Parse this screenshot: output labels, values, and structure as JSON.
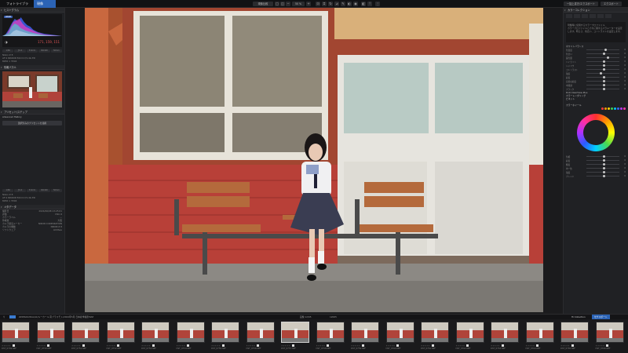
{
  "topbar": {
    "tabs": [
      "フォトライブラリ",
      "現像"
    ],
    "center_buttons": [
      "現像比較"
    ],
    "zoom": "50 %",
    "right_buttons": [
      "一括上書き/エクスポート",
      "エクスポート"
    ]
  },
  "left_panel": {
    "histogram_title": "ヒストグラム",
    "histogram_badge": "sRGB",
    "rgb_readout": "171, 159, 151",
    "exif_chips": [
      "1/80",
      "ƒ/1.4",
      "5.6mm",
      "ISO400",
      "50mm"
    ],
    "exif_line1": "Nikon Z 8",
    "exif_line2": "AF-S NIKKOR 50mm f/1.4G ED",
    "exif_line3": "8256 × 5504",
    "navigator_title": "情報パネル",
    "presets_title": "プリセット/ステップ",
    "history_label": "Advanced History",
    "history_button": "選択済みのプリセットを適用",
    "lower_exif_chips": [
      "1/80",
      "ƒ/1.4",
      "5.6mm",
      "ISO400",
      "50mm"
    ],
    "lower_line1": "Nikon Z 8",
    "lower_line2": "AF-S NIKKOR 50mm f/1.4G ED",
    "lower_line3": "8256 × 5504",
    "meta_title": "メタデータ",
    "meta_rows": [
      [
        "撮影日",
        "2024/06/08 13:25:01"
      ],
      [
        "評価",
        "DSC-9"
      ],
      [
        "カラーラベル",
        "—"
      ],
      [
        "作成者",
        "大阪"
      ],
      [
        "カメラ製造メーカー",
        "NIKON CORPORATION"
      ],
      [
        "カメラの機種",
        "NIKON Z 8"
      ],
      [
        "ソフトウェア",
        "ACDSee"
      ]
    ]
  },
  "right_panel": {
    "title": "カラーコレクション",
    "note_line1": "現像時に使用するカラープロファイル",
    "note_line2": "カラープロファイルとそれに関するパラメーターを設定",
    "note_line3": "します。明るさ、色合い、コントラストを設定します。",
    "sections": [
      "ホワイトバランス",
      "露出補正",
      "トーン",
      "DxO ClearView Plus",
      "カラーレンダリング",
      "ビネット",
      "カラーホイール"
    ],
    "sliders": [
      {
        "label": "色温度",
        "pos": 0.55,
        "value": "0"
      },
      {
        "label": "色合い",
        "pos": 0.5,
        "value": "0"
      },
      {
        "label": "露光量",
        "pos": 0.62,
        "value": "0"
      },
      {
        "label": "ハイライト",
        "pos": 0.5,
        "value": "0"
      },
      {
        "label": "シャドウ",
        "pos": 0.5,
        "value": "0"
      },
      {
        "label": "コントラスト",
        "pos": 0.5,
        "value": "0"
      },
      {
        "label": "強度",
        "pos": 0.4,
        "value": "0"
      },
      {
        "label": "彩度",
        "pos": 0.5,
        "value": "0"
      },
      {
        "label": "自然な彩度",
        "pos": 0.5,
        "value": "0"
      },
      {
        "label": "中間調",
        "pos": 0.5,
        "value": "0"
      },
      {
        "label": "ブラック",
        "pos": 0.5,
        "value": "0"
      }
    ],
    "lower_sliders": [
      {
        "label": "色相",
        "pos": 0.5,
        "value": "0"
      },
      {
        "label": "彩度",
        "pos": 0.5,
        "value": "0"
      },
      {
        "label": "輝度",
        "pos": 0.5,
        "value": "0"
      },
      {
        "label": "均一性",
        "pos": 0.5,
        "value": "0"
      },
      {
        "label": "強度",
        "pos": 0.5,
        "value": "0"
      },
      {
        "label": "ブレンド",
        "pos": 0.5,
        "value": "0"
      }
    ],
    "swatch_colors": [
      "#ff3a3a",
      "#ff9a00",
      "#ffd600",
      "#3fd04f",
      "#00c8ff",
      "#3a63ff",
      "#b438ff",
      "#ff38a8"
    ]
  },
  "filmstrip_bar": {
    "path": "ZZDMA02DAA/Lt/ルーカール 南ブラスモト/2024年5月 日本夏季撮影MAP",
    "center_label": "画像 12/65",
    "center_count": "12065",
    "collection": "Hi Collection",
    "button": "セクスポート"
  },
  "thumbnails": [
    {
      "name": "DST_0749.NEF",
      "selected": false
    },
    {
      "name": "DST_0750.NEF",
      "selected": false
    },
    {
      "name": "DST_0751.NEF",
      "selected": false
    },
    {
      "name": "DST_0752.NEF",
      "selected": false
    },
    {
      "name": "DST_0753.NEF",
      "selected": false
    },
    {
      "name": "DST_0754.NEF",
      "selected": false
    },
    {
      "name": "DST_0755.NEF",
      "selected": false
    },
    {
      "name": "DST_0756.NEF",
      "selected": false
    },
    {
      "name": "DST_0757.NEF",
      "selected": true
    },
    {
      "name": "DST_0758.NEF",
      "selected": false
    },
    {
      "name": "DST_0759.NEF",
      "selected": false
    },
    {
      "name": "DST_0760.NEF",
      "selected": false
    },
    {
      "name": "DST_0761.NEF",
      "selected": false
    },
    {
      "name": "DST_0762.NEF",
      "selected": false
    },
    {
      "name": "DST_0763.NEF",
      "selected": false
    },
    {
      "name": "DST_0764.NEF",
      "selected": false
    },
    {
      "name": "DST_0765.NEF",
      "selected": false
    },
    {
      "name": "DST_0766.NEF",
      "selected": false
    }
  ]
}
